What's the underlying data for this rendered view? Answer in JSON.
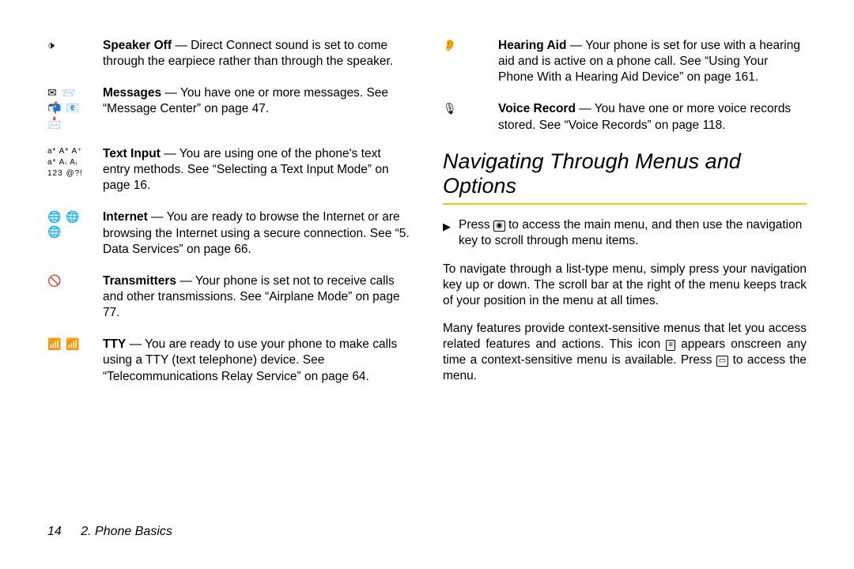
{
  "left_items": [
    {
      "iconset": "🕩",
      "bold": "Speaker Off",
      "text": " — Direct Connect sound is set to come through the earpiece rather than through the speaker."
    },
    {
      "iconset": "✉ 📨\n📬 📧\n📩",
      "bold": "Messages",
      "text": " — You have one or more messages. See “Message Center” on page 47."
    },
    {
      "iconset_tiny": "a* A* A⁺\na* Aᵢ Aᵢ\n123 @?!",
      "bold": "Text Input",
      "text": " — You are using one of the phone's text entry methods. See “Selecting a Text Input Mode” on page 16."
    },
    {
      "iconset": "🌐 🌐\n🌐",
      "bold": "Internet",
      "text": " — You are ready to browse the Internet or are browsing the Internet using a secure connection. See “5. Data Services” on page 66."
    },
    {
      "iconset": "🚫",
      "bold": "Transmitters",
      "text": " — Your phone is set not to receive calls and other transmissions. See “Airplane Mode” on page 77."
    },
    {
      "iconset": "📶 📶",
      "bold": "TTY",
      "text": " — You are ready to use your phone to make calls using a TTY (text telephone) device. See “Telecommunications Relay Service” on page 64."
    }
  ],
  "right_items": [
    {
      "iconset": "👂",
      "bold": "Hearing Aid",
      "text": " — Your phone is set for use with a hearing aid and is active on a phone call. See “Using Your Phone With a Hearing Aid Device” on page 161."
    },
    {
      "iconset": "🎙",
      "bold": "Voice Record",
      "text": " — You have one or more voice records stored. See “Voice Records” on page 118."
    }
  ],
  "heading": "Navigating Through Menus and Options",
  "bullet": {
    "mark": "▶",
    "pre": "Press ",
    "key1": "◉",
    "post": " to access the main menu, and then use the navigation key to scroll through menu items."
  },
  "para1": "To navigate through a list-type menu, simply press your navigation key up or down. The scroll bar at the right of the menu keeps track of your position in the menu at all times.",
  "para2_a": "Many features provide context-sensitive menus that let you access related features and actions. This icon ",
  "para2_icon": "≡",
  "para2_b": " appears onscreen any time a context-sensitive menu is available. Press ",
  "para2_key": "▭",
  "para2_c": " to access the menu.",
  "footer_page": "14",
  "footer_section": "2. Phone Basics"
}
